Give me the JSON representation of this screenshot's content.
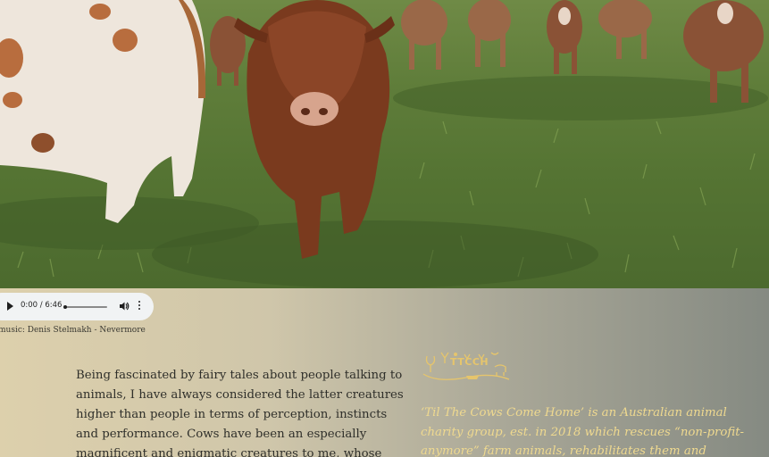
{
  "audio": {
    "time": "0:00 / 6:46",
    "progress": 0,
    "icons": [
      "play-icon",
      "volume-icon",
      "more-options-icon"
    ]
  },
  "music_credit": "music: Denis Stelmakh - Nevermore",
  "story_text": "Being fascinated by fairy tales about people talking to animals, I have always considered the latter creatures higher than people in terms of perception, instincts and performance. Cows have been an especially magnificent and enigmatic creatures to me, whose",
  "logo": {
    "text": "TTCCH"
  },
  "mission_text": "‘Til The Cows Come Home’ is an Australian animal charity group, est. in 2018 which rescues “non-profit-anymore” farm animals, rehabilitates them and",
  "colors": {
    "logo": "#e6c56c",
    "mission": "#efd98f",
    "body_text": "#2f2f2a"
  }
}
